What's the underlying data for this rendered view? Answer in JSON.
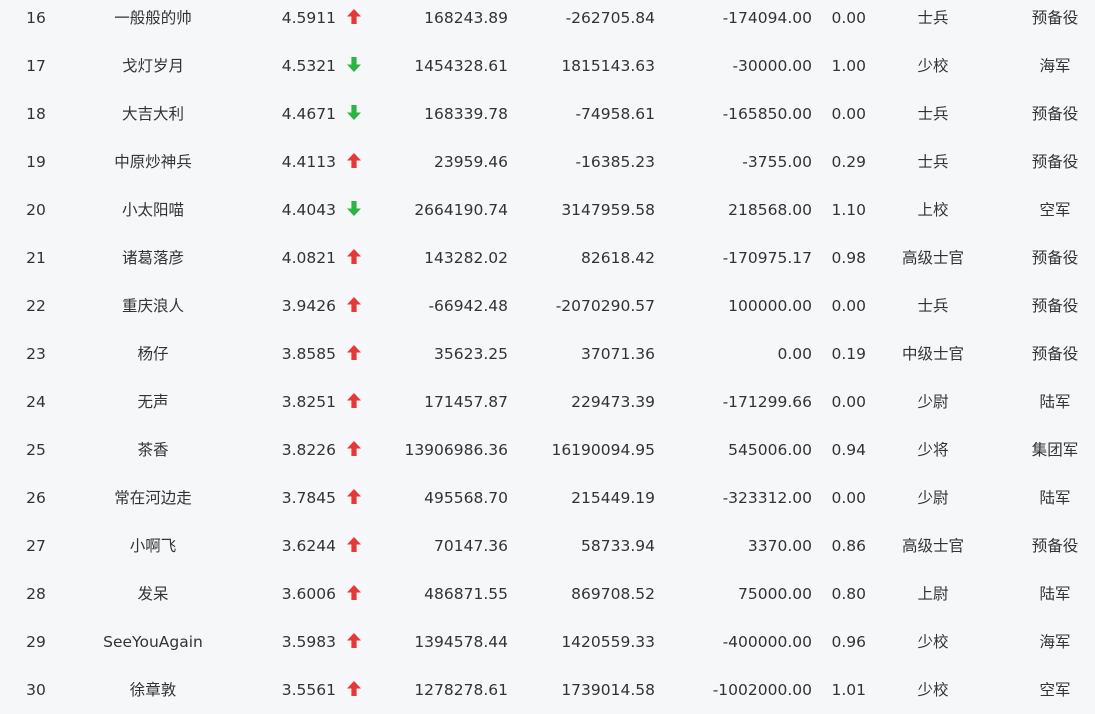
{
  "colors": {
    "up": "#e5383b",
    "down": "#2fb344",
    "text": "#333333",
    "background": "#f6f7f9"
  },
  "rows": [
    {
      "rank": "16",
      "name": "一般般的帅",
      "score": "4.5911",
      "trend": "up",
      "v1": "168243.89",
      "v2": "-262705.84",
      "v3": "-174094.00",
      "ratio": "0.00",
      "rank_title": "士兵",
      "branch": "预备役"
    },
    {
      "rank": "17",
      "name": "戈灯岁月",
      "score": "4.5321",
      "trend": "down",
      "v1": "1454328.61",
      "v2": "1815143.63",
      "v3": "-30000.00",
      "ratio": "1.00",
      "rank_title": "少校",
      "branch": "海军"
    },
    {
      "rank": "18",
      "name": "大吉大利",
      "score": "4.4671",
      "trend": "down",
      "v1": "168339.78",
      "v2": "-74958.61",
      "v3": "-165850.00",
      "ratio": "0.00",
      "rank_title": "士兵",
      "branch": "预备役"
    },
    {
      "rank": "19",
      "name": "中原炒神兵",
      "score": "4.4113",
      "trend": "up",
      "v1": "23959.46",
      "v2": "-16385.23",
      "v3": "-3755.00",
      "ratio": "0.29",
      "rank_title": "士兵",
      "branch": "预备役"
    },
    {
      "rank": "20",
      "name": "小太阳喵",
      "score": "4.4043",
      "trend": "down",
      "v1": "2664190.74",
      "v2": "3147959.58",
      "v3": "218568.00",
      "ratio": "1.10",
      "rank_title": "上校",
      "branch": "空军"
    },
    {
      "rank": "21",
      "name": "诸葛落彦",
      "score": "4.0821",
      "trend": "up",
      "v1": "143282.02",
      "v2": "82618.42",
      "v3": "-170975.17",
      "ratio": "0.98",
      "rank_title": "高级士官",
      "branch": "预备役"
    },
    {
      "rank": "22",
      "name": "重庆浪人",
      "score": "3.9426",
      "trend": "up",
      "v1": "-66942.48",
      "v2": "-2070290.57",
      "v3": "100000.00",
      "ratio": "0.00",
      "rank_title": "士兵",
      "branch": "预备役"
    },
    {
      "rank": "23",
      "name": "杨仔",
      "score": "3.8585",
      "trend": "up",
      "v1": "35623.25",
      "v2": "37071.36",
      "v3": "0.00",
      "ratio": "0.19",
      "rank_title": "中级士官",
      "branch": "预备役"
    },
    {
      "rank": "24",
      "name": "无声",
      "score": "3.8251",
      "trend": "up",
      "v1": "171457.87",
      "v2": "229473.39",
      "v3": "-171299.66",
      "ratio": "0.00",
      "rank_title": "少尉",
      "branch": "陆军"
    },
    {
      "rank": "25",
      "name": "茶香",
      "score": "3.8226",
      "trend": "up",
      "v1": "13906986.36",
      "v2": "16190094.95",
      "v3": "545006.00",
      "ratio": "0.94",
      "rank_title": "少将",
      "branch": "集团军"
    },
    {
      "rank": "26",
      "name": "常在河边走",
      "score": "3.7845",
      "trend": "up",
      "v1": "495568.70",
      "v2": "215449.19",
      "v3": "-323312.00",
      "ratio": "0.00",
      "rank_title": "少尉",
      "branch": "陆军"
    },
    {
      "rank": "27",
      "name": "小啊飞",
      "score": "3.6244",
      "trend": "up",
      "v1": "70147.36",
      "v2": "58733.94",
      "v3": "3370.00",
      "ratio": "0.86",
      "rank_title": "高级士官",
      "branch": "预备役"
    },
    {
      "rank": "28",
      "name": "发呆",
      "score": "3.6006",
      "trend": "up",
      "v1": "486871.55",
      "v2": "869708.52",
      "v3": "75000.00",
      "ratio": "0.80",
      "rank_title": "上尉",
      "branch": "陆军"
    },
    {
      "rank": "29",
      "name": "SeeYouAgain",
      "score": "3.5983",
      "trend": "up",
      "v1": "1394578.44",
      "v2": "1420559.33",
      "v3": "-400000.00",
      "ratio": "0.96",
      "rank_title": "少校",
      "branch": "海军"
    },
    {
      "rank": "30",
      "name": "徐章敦",
      "score": "3.5561",
      "trend": "up",
      "v1": "1278278.61",
      "v2": "1739014.58",
      "v3": "-1002000.00",
      "ratio": "1.01",
      "rank_title": "少校",
      "branch": "空军"
    }
  ]
}
